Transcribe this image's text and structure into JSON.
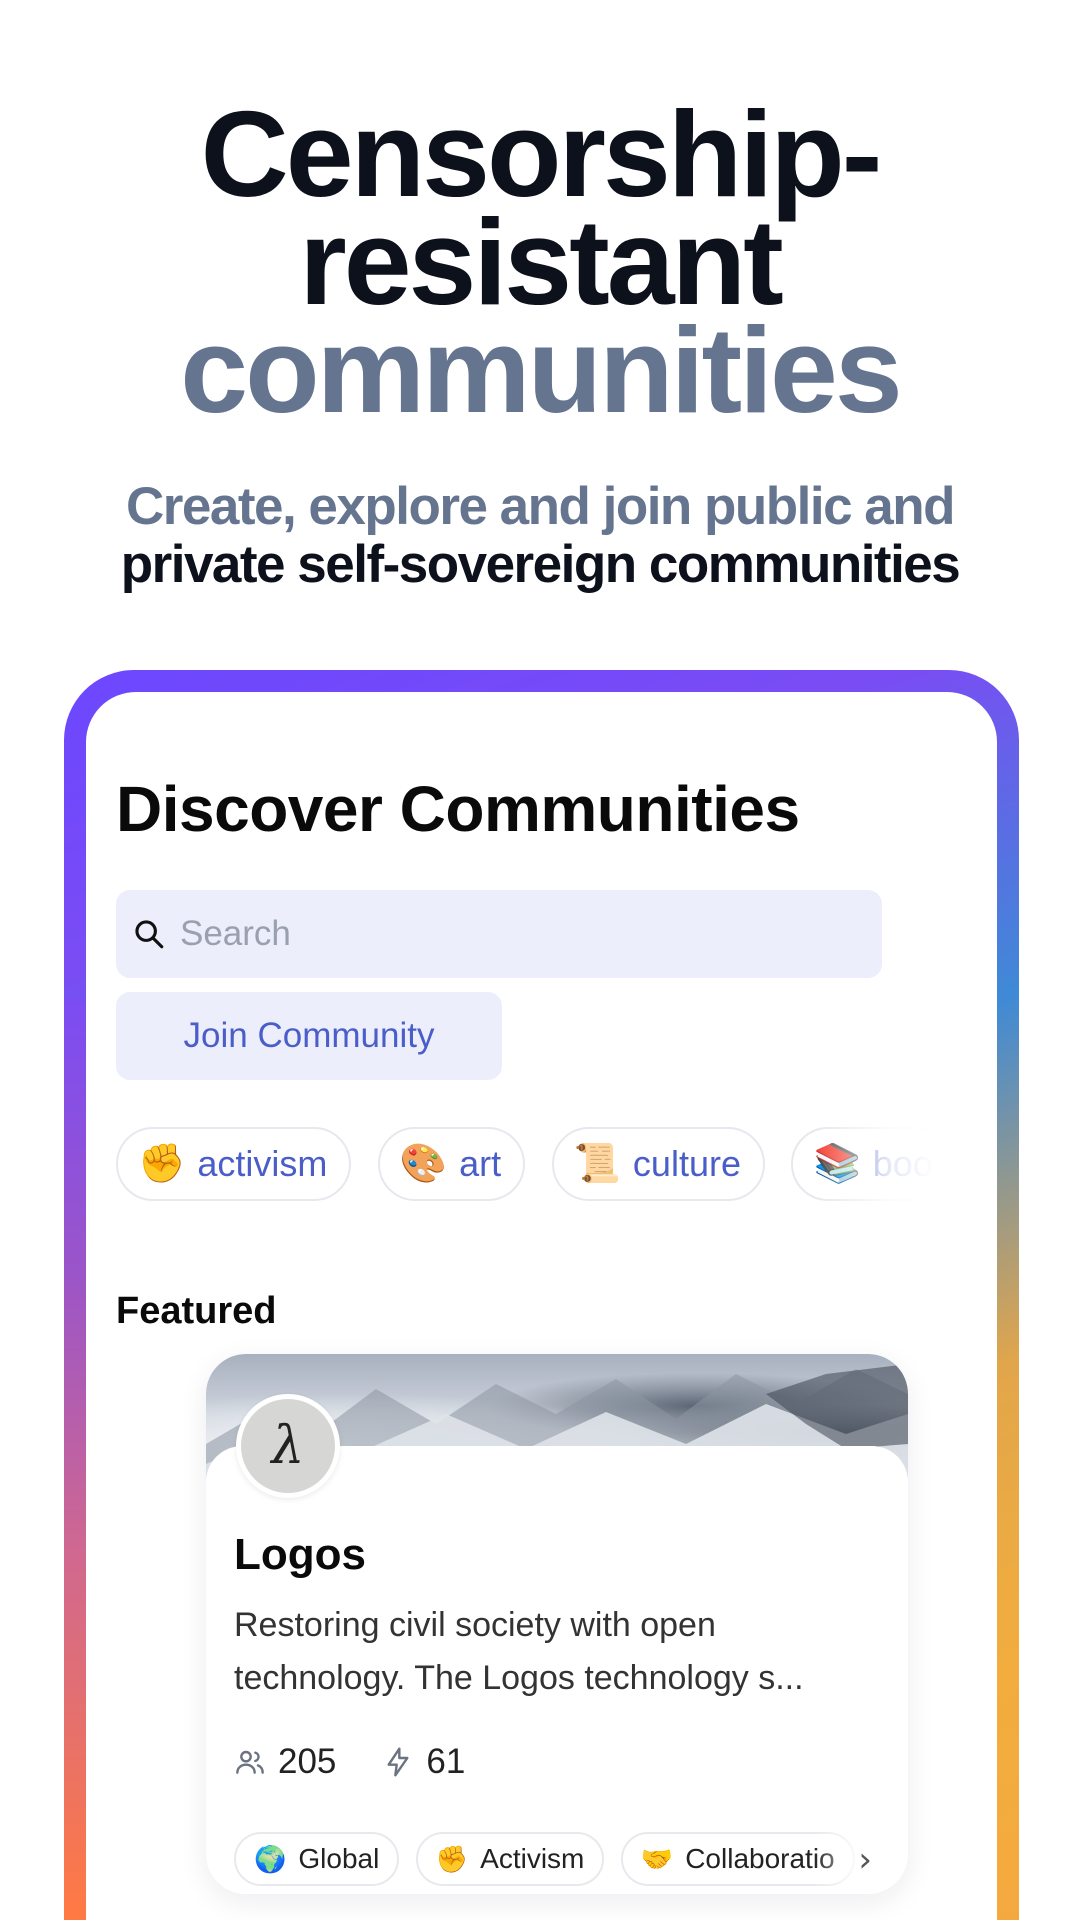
{
  "hero": {
    "title_line1": "Censorship-",
    "title_line2": "resistant",
    "title_line3": "communities",
    "subtitle_line1": "Create, explore and join public and",
    "subtitle_line2": "private self-sovereign communities"
  },
  "screen": {
    "title": "Discover Communities",
    "search": {
      "placeholder": "Search",
      "icon": "search-icon"
    },
    "join_button": "Join Community",
    "categories": [
      {
        "emoji": "✊",
        "label": "activism"
      },
      {
        "emoji": "🎨",
        "label": "art"
      },
      {
        "emoji": "📜",
        "label": "culture"
      },
      {
        "emoji": "📚",
        "label": "boo"
      }
    ],
    "featured_label": "Featured",
    "featured_card": {
      "avatar_glyph": "λ",
      "name": "Logos",
      "description": "Restoring civil society with open technology. The Logos technology s...",
      "members_count": "205",
      "active_count": "61",
      "members_icon": "users-icon",
      "active_icon": "lightning-icon",
      "tags": [
        {
          "emoji": "🌍",
          "label": "Global"
        },
        {
          "emoji": "✊",
          "label": "Activism"
        },
        {
          "emoji": "🤝",
          "label": "Collaboratio"
        }
      ],
      "more_icon": "chevron-right-icon"
    }
  },
  "colors": {
    "accent": "#4a5dc8",
    "muted_text": "#66758f",
    "dark_text": "#0d111c",
    "input_bg": "#eceefb"
  }
}
